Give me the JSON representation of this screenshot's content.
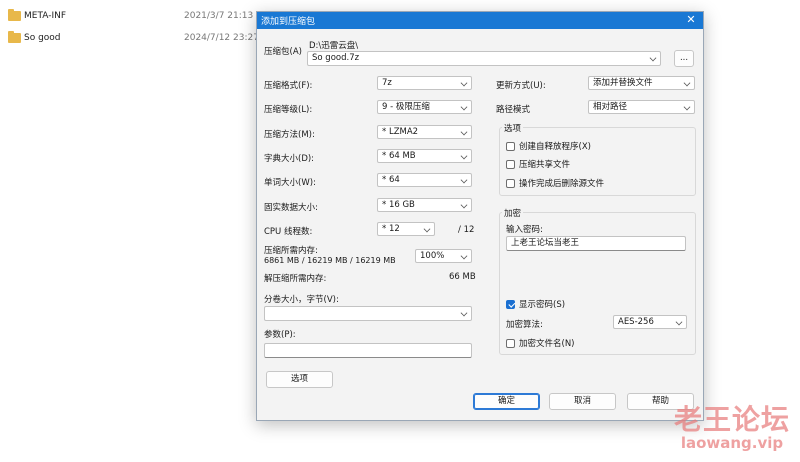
{
  "explorer": {
    "rows": [
      {
        "name": "META-INF",
        "date": "2021/3/7 21:13"
      },
      {
        "name": "So good",
        "date": "2024/7/12 23:27"
      }
    ]
  },
  "dialog": {
    "title": "添加到压缩包",
    "close_glyph": "✕",
    "archive_label": "压缩包(A)",
    "archive_path": "D:\\迅雷云盘\\",
    "archive_name": "So good.7z",
    "browse_label": "...",
    "format_label": "压缩格式(F):",
    "format_value": "7z",
    "level_label": "压缩等级(L):",
    "level_value": "9 - 极限压缩",
    "method_label": "压缩方法(M):",
    "method_value": "* LZMA2",
    "dict_label": "字典大小(D):",
    "dict_value": "* 64 MB",
    "word_label": "单词大小(W):",
    "word_value": "* 64",
    "solid_label": "固实数据大小:",
    "solid_value": "* 16 GB",
    "cpu_label": "CPU 线程数:",
    "cpu_value": "* 12",
    "cpu_max": "/ 12",
    "mem_label": "压缩所需内存:",
    "mem_value": "6861 MB / 16219 MB / 16219 MB",
    "mem_percent": "100%",
    "decomp_label": "解压缩所需内存:",
    "decomp_value": "66 MB",
    "split_label": "分卷大小，字节(V):",
    "split_value": "",
    "params_label": "参数(P):",
    "params_value": "",
    "options_button": "选项",
    "update_label": "更新方式(U):",
    "update_value": "添加并替换文件",
    "path_label": "路径模式",
    "path_value": "相对路径",
    "options_group": {
      "title": "选项",
      "items": [
        {
          "label": "创建自释放程序(X)",
          "checked": false
        },
        {
          "label": "压缩共享文件",
          "checked": false
        },
        {
          "label": "操作完成后删除源文件",
          "checked": false
        }
      ]
    },
    "encrypt_group": {
      "title": "加密",
      "password_label": "输入密码:",
      "password_value": "上老王论坛当老王",
      "show_password_label": "显示密码(S)",
      "show_password_checked": true,
      "algo_label": "加密算法:",
      "algo_value": "AES-256",
      "encrypt_names_label": "加密文件名(N)",
      "encrypt_names_checked": false
    },
    "ok_label": "确定",
    "cancel_label": "取消",
    "help_label": "帮助"
  },
  "watermark": {
    "cn": "老王论坛",
    "en": "laowang.vip"
  }
}
